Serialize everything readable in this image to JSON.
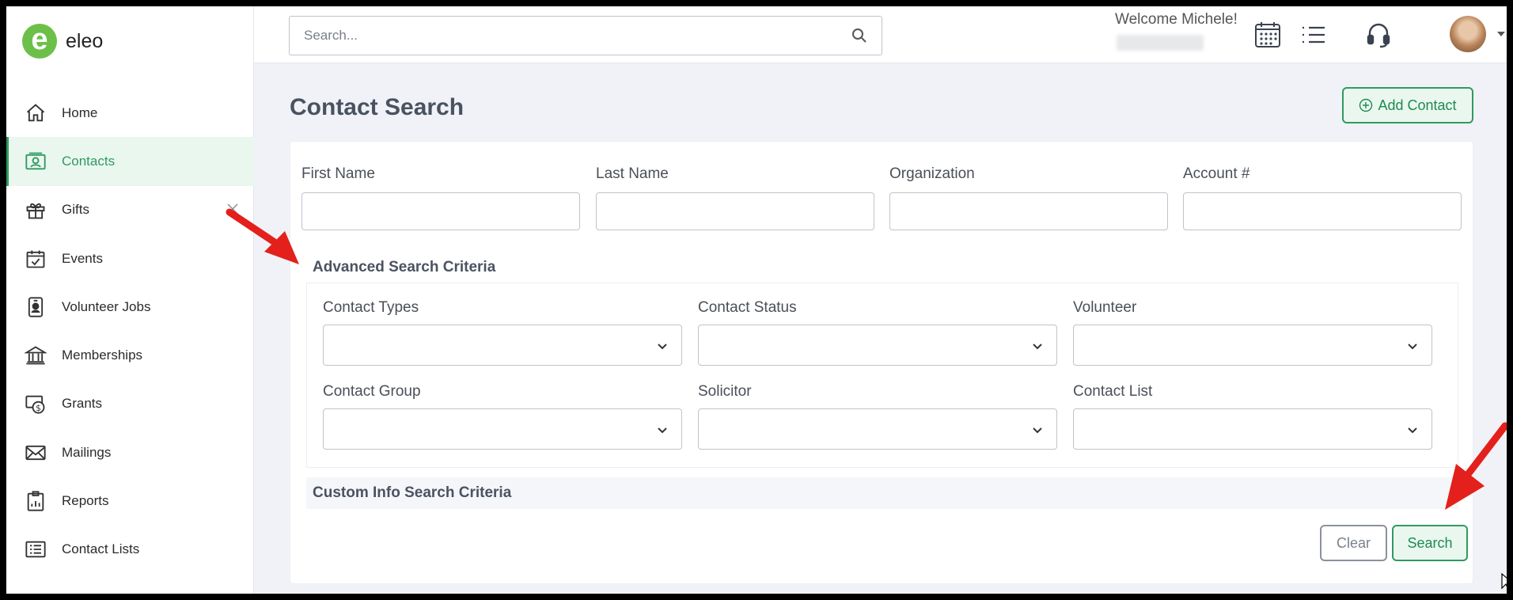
{
  "app": {
    "logo_text": "eleo"
  },
  "sidebar": {
    "items": [
      {
        "label": "Home",
        "icon": "home-icon"
      },
      {
        "label": "Contacts",
        "icon": "contacts-icon",
        "active": true
      },
      {
        "label": "Gifts",
        "icon": "gift-icon"
      },
      {
        "label": "Events",
        "icon": "calendar-check-icon"
      },
      {
        "label": "Volunteer Jobs",
        "icon": "id-badge-icon"
      },
      {
        "label": "Memberships",
        "icon": "bank-icon"
      },
      {
        "label": "Grants",
        "icon": "grant-money-icon"
      },
      {
        "label": "Mailings",
        "icon": "envelope-icon"
      },
      {
        "label": "Reports",
        "icon": "report-icon"
      },
      {
        "label": "Contact Lists",
        "icon": "list-icon"
      }
    ]
  },
  "topbar": {
    "search_placeholder": "Search...",
    "welcome": "Welcome Michele!"
  },
  "page": {
    "title": "Contact Search",
    "add_contact": "Add Contact"
  },
  "search_form": {
    "fields": {
      "first_name": "First Name",
      "last_name": "Last Name",
      "organization": "Organization",
      "account": "Account #"
    },
    "advanced_title": "Advanced Search Criteria",
    "advanced": {
      "contact_types": "Contact Types",
      "contact_status": "Contact Status",
      "volunteer": "Volunteer",
      "contact_group": "Contact Group",
      "solicitor": "Solicitor",
      "contact_list": "Contact List"
    },
    "custom_title": "Custom Info Search Criteria",
    "clear": "Clear",
    "search": "Search"
  },
  "colors": {
    "brand_green": "#2f9a61",
    "logo_green": "#6cc04a",
    "annotation_red": "#e3201b"
  }
}
